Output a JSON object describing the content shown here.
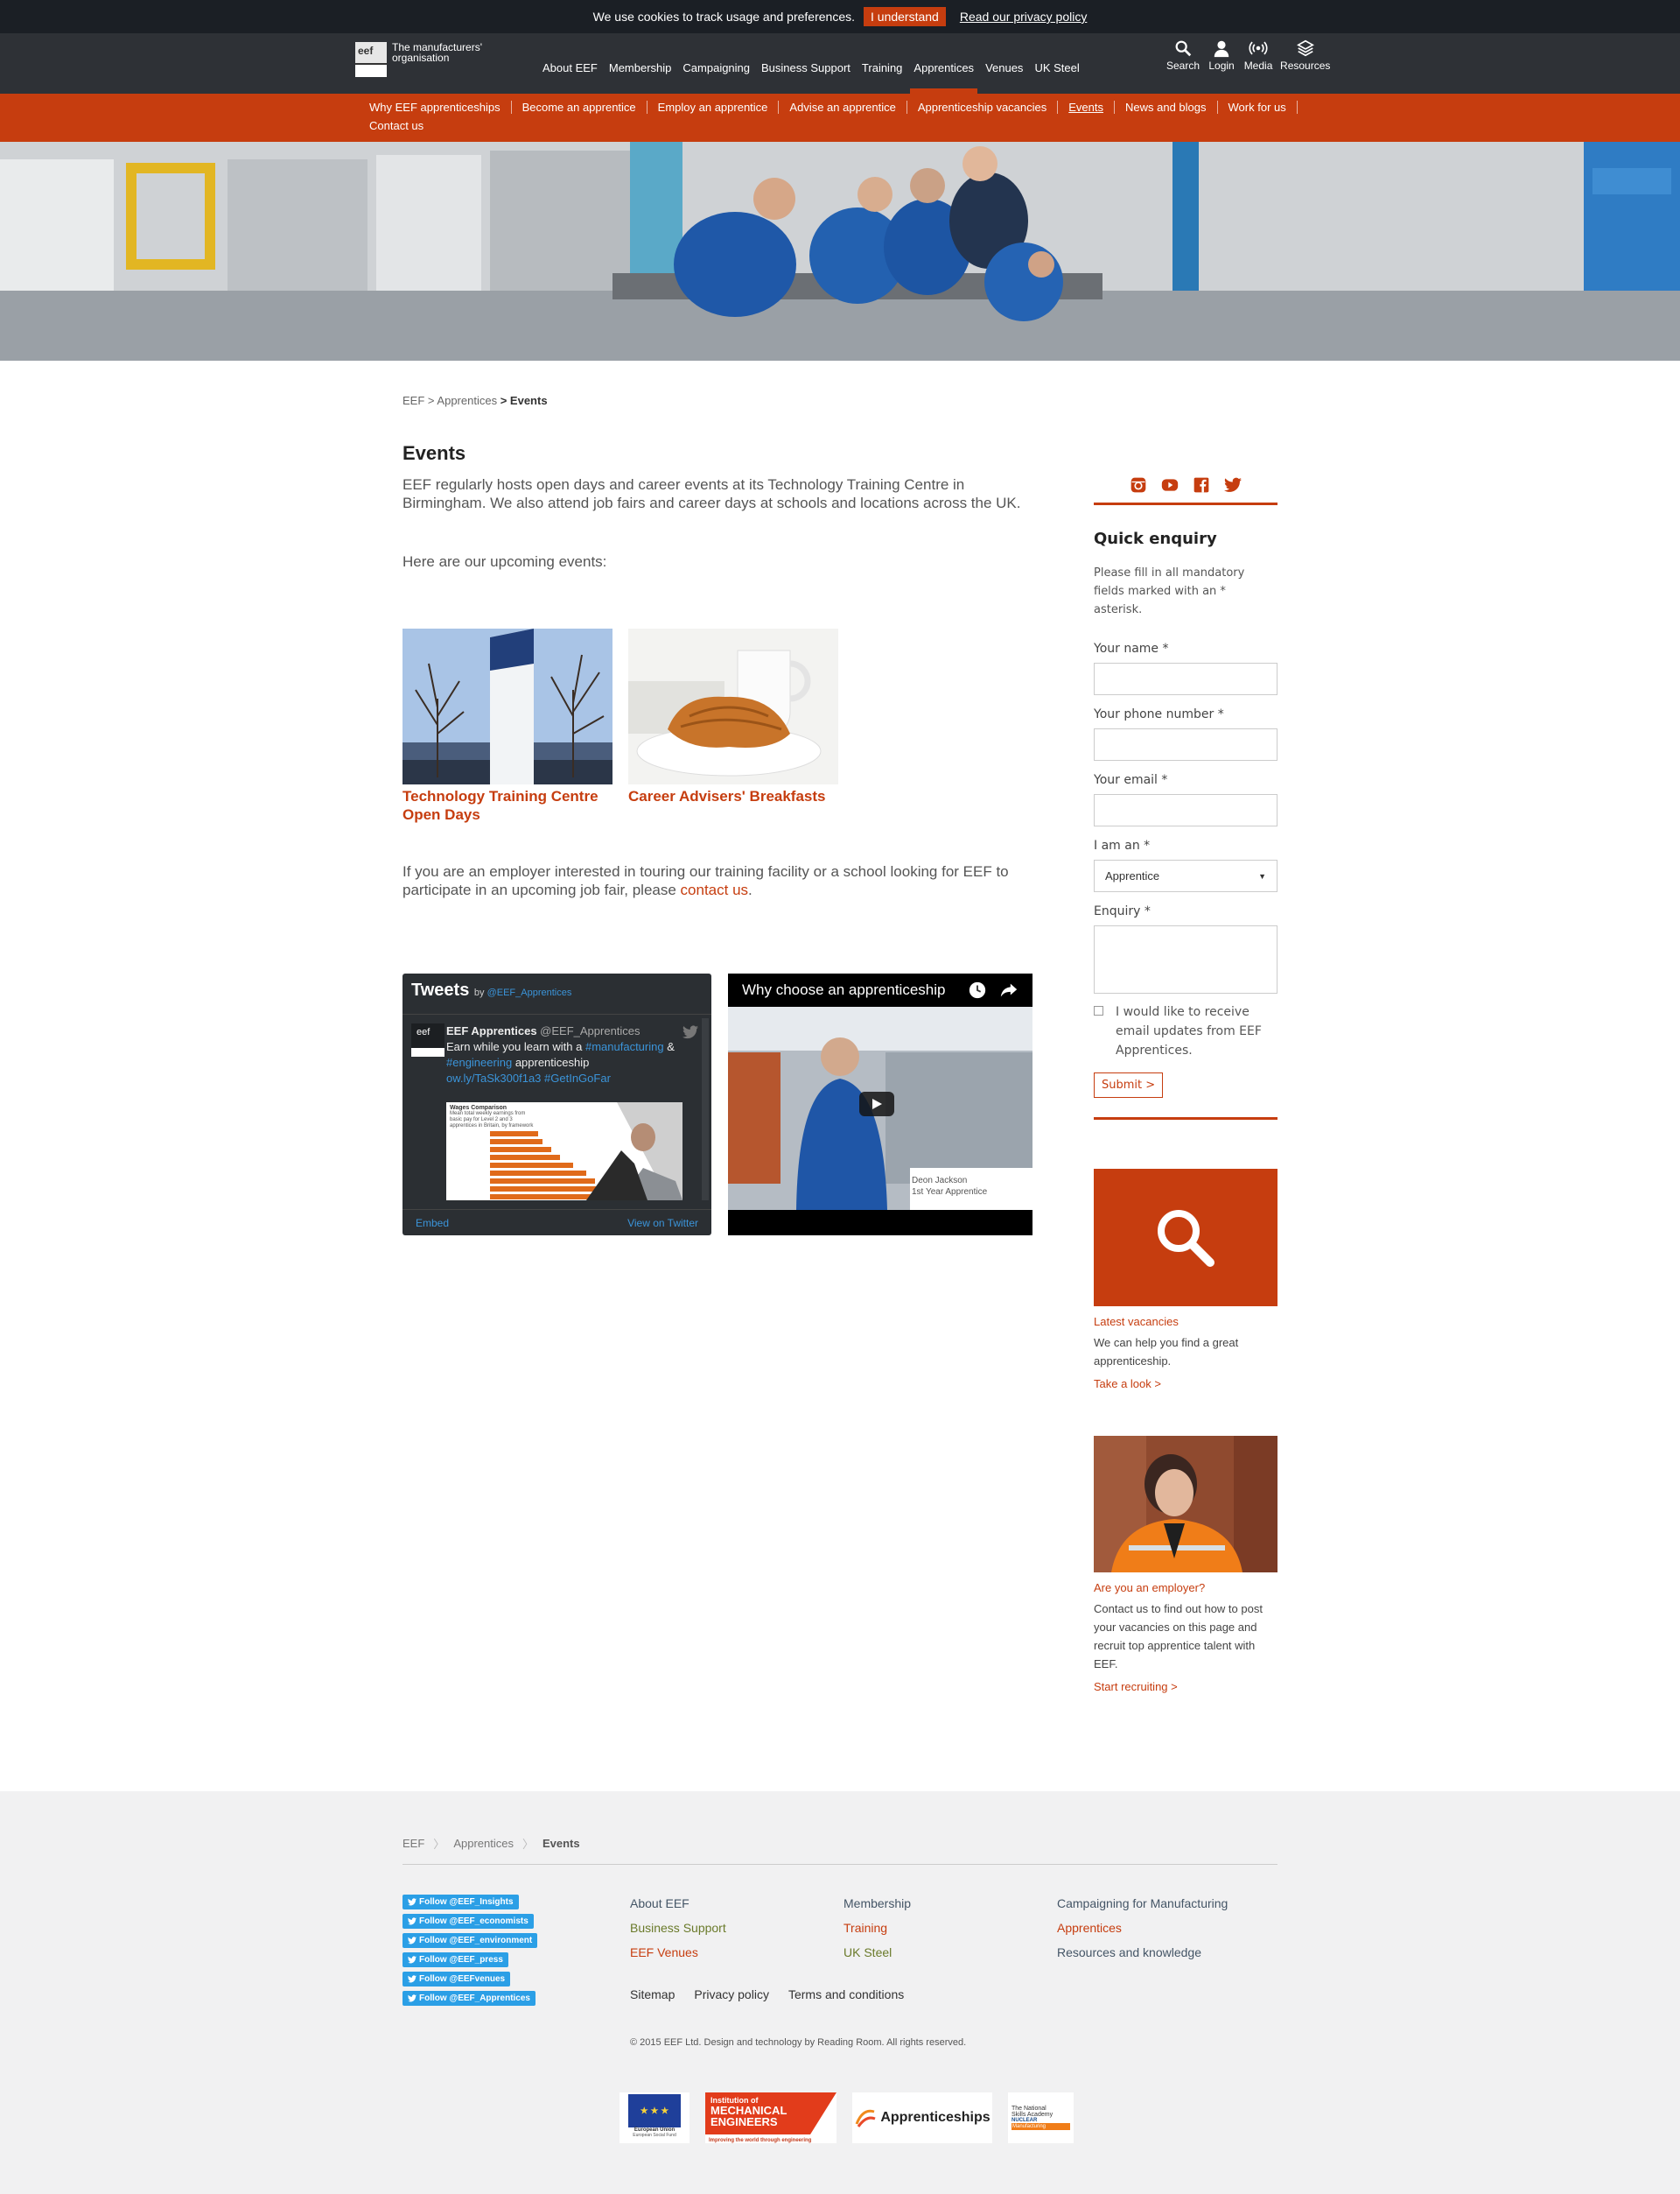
{
  "cookie": {
    "text": "We use cookies to track usage and preferences.",
    "ok": "I understand",
    "policy": "Read our privacy policy"
  },
  "logo": {
    "mark": "eef",
    "tagline": "The manufacturers' organisation"
  },
  "nav": [
    "About EEF",
    "Membership",
    "Campaigning",
    "Business Support",
    "Training",
    "Apprentices",
    "Venues",
    "UK Steel"
  ],
  "tools": {
    "search": "Search",
    "login": "Login",
    "media": "Media",
    "resources": "Resources"
  },
  "subnav": [
    "Why EEF apprenticeships",
    "Become an apprentice",
    "Employ an apprentice",
    "Advise an apprentice",
    "Apprenticeship vacancies",
    "Events",
    "News and blogs",
    "Work for us",
    "Contact us"
  ],
  "breadcrumb": {
    "a": "EEF",
    "sep1": ">",
    "b": "Apprentices",
    "sep2": ">",
    "c": "Events"
  },
  "main": {
    "title": "Events",
    "intro": "EEF regularly hosts open days and career events at its Technology Training Centre in Birmingham. We also attend job fairs and career days at schools and locations across the UK.",
    "intro2": "Here are our upcoming events:",
    "cards": [
      {
        "title": "Technology Training Centre Open Days"
      },
      {
        "title": "Career Advisers' Breakfasts"
      }
    ],
    "outro_pre": "If you are an employer interested in touring our training facility or a school looking for EEF to participate in an upcoming job fair, please ",
    "outro_link": "contact us",
    "outro_post": "."
  },
  "tweets": {
    "header": "Tweets",
    "by": "by",
    "handle": "@EEF_Apprentices",
    "account": "EEF Apprentices",
    "account_handle": "@EEF_Apprentices",
    "line1": "Earn while you learn with a",
    "tag1": "#manufacturing",
    "amp": "&",
    "tag2": "#engineering",
    "line2": "apprenticeship",
    "link": "ow.ly/TaSk300f1a3",
    "tag3": "#GetInGoFar",
    "chart_title": "Wages Comparison",
    "chart_sub": "Mean total weekly earnings from basic pay for Level 2 and 3 apprentices in Britain, by framework",
    "embed": "Embed",
    "view": "View on Twitter"
  },
  "video": {
    "title": "Why choose an apprenticeship",
    "caption_name": "Deon Jackson",
    "caption_role": "1st Year Apprentice"
  },
  "enquiry": {
    "title": "Quick enquiry",
    "note": "Please fill in all mandatory fields marked with an * asterisk.",
    "name": "Your name *",
    "phone": "Your phone number *",
    "email": "Your email *",
    "iam": "I am an *",
    "iam_value": "Apprentice",
    "enquiry": "Enquiry *",
    "optin": "I would like to receive email updates from EEF Apprentices.",
    "submit": "Submit >"
  },
  "vacancies": {
    "title": "Latest vacancies",
    "text": "We can help you find a great apprenticeship.",
    "link": "Take a look >"
  },
  "employer": {
    "title": "Are you an employer?",
    "text": "Contact us to find out how to post your vacancies on this page and recruit top apprentice talent with EEF.",
    "link": "Start recruiting >"
  },
  "footer": {
    "crumb": [
      "EEF",
      "Apprentices",
      "Events"
    ],
    "follow": [
      "Follow @EEF_Insights",
      "Follow @EEF_economists",
      "Follow @EEF_environment",
      "Follow @EEF_press",
      "Follow @EEFvenues",
      "Follow @EEF_Apprentices"
    ],
    "col1": [
      "About EEF",
      "Business Support",
      "EEF Venues"
    ],
    "col2": [
      "Membership",
      "Training",
      "UK Steel"
    ],
    "col3": [
      "Campaigning for Manufacturing",
      "Apprentices",
      "Resources and knowledge"
    ],
    "legal": [
      "Sitemap",
      "Privacy policy",
      "Terms and conditions"
    ],
    "copyright": "© 2015 EEF Ltd. Design and technology by Reading Room. All rights reserved.",
    "partners": {
      "eu": "European Union",
      "eu_sub": "European Social Fund",
      "ime1": "Institution of",
      "ime2": "MECHANICAL",
      "ime3": "ENGINEERS",
      "ime_tag": "Improving the world through engineering",
      "app": "Apprenticeships",
      "nsa1": "The National",
      "nsa2": "Skills Academy",
      "nsa3": "NUCLEAR",
      "nsa4": "Manufacturing"
    }
  },
  "colors": {
    "accent": "#c63d0f",
    "dark": "#2e3136",
    "cookie_bg": "#1b1f25",
    "twitter": "#2b9fe6"
  }
}
